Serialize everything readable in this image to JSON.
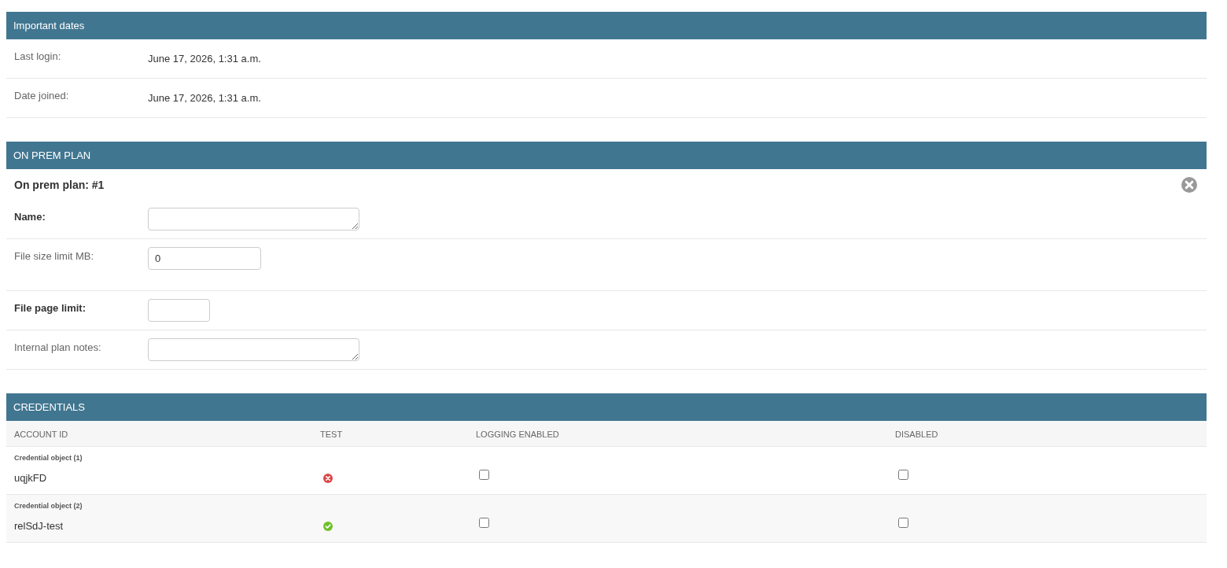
{
  "important_dates": {
    "title": "Important dates",
    "rows": [
      {
        "label": "Last login:",
        "value": "June 17, 2026, 1:31 a.m."
      },
      {
        "label": "Date joined:",
        "value": "June 17, 2026, 1:31 a.m."
      }
    ]
  },
  "on_prem_plan": {
    "title": "ON PREM PLAN",
    "item_title": "On prem plan: #1",
    "fields": [
      {
        "label": "Name:",
        "required": true,
        "kind": "textarea"
      },
      {
        "label": "File size limit MB:",
        "required": false,
        "kind": "number-input",
        "value": "0"
      },
      {
        "label": "File page limit:",
        "required": true,
        "kind": "short-input"
      },
      {
        "label": "Internal plan notes:",
        "required": false,
        "kind": "textarea"
      }
    ]
  },
  "credentials": {
    "title": "CREDENTIALS",
    "columns": [
      "ACCOUNT ID",
      "TEST",
      "LOGGING ENABLED",
      "DISABLED"
    ],
    "rows": [
      {
        "caption": "Credential object (1)",
        "account_id": "uqjkFD",
        "test_passed": false,
        "logging_enabled": false,
        "disabled": false
      },
      {
        "caption": "Credential object (2)",
        "account_id": "relSdJ-test",
        "test_passed": true,
        "logging_enabled": false,
        "disabled": false
      }
    ]
  }
}
